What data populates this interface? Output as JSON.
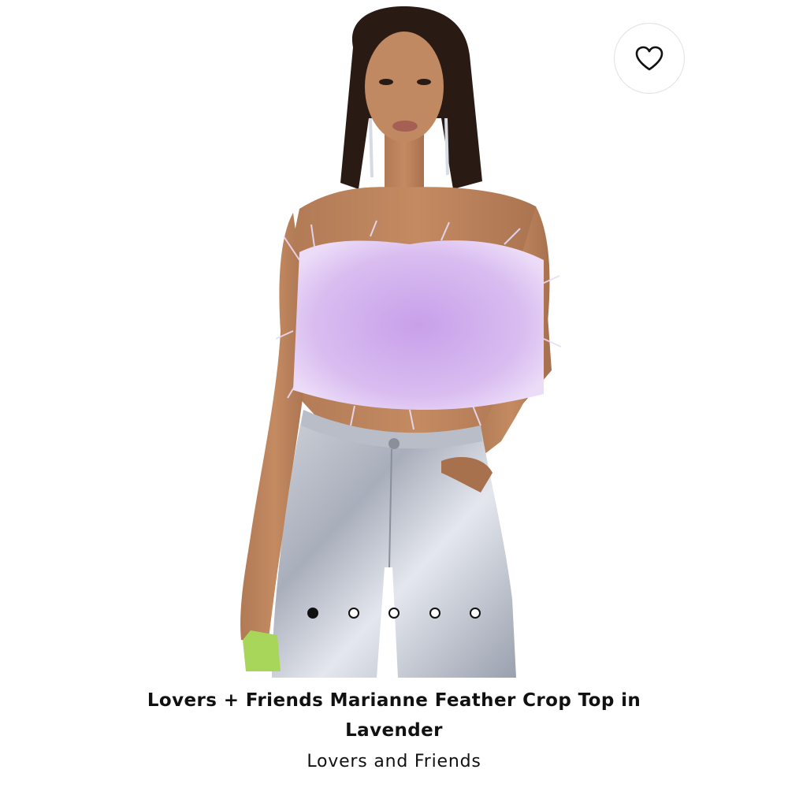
{
  "product": {
    "title": "Lovers + Friends Marianne Feather Crop Top in Lavender",
    "brand": "Lovers and Friends",
    "image_icon": "model-photo",
    "wishlist_icon": "heart-outline-icon"
  },
  "carousel": {
    "total_images": 5,
    "current_index": 1
  },
  "colors": {
    "accent": "#111111",
    "top_color": "#c9a2e8"
  }
}
